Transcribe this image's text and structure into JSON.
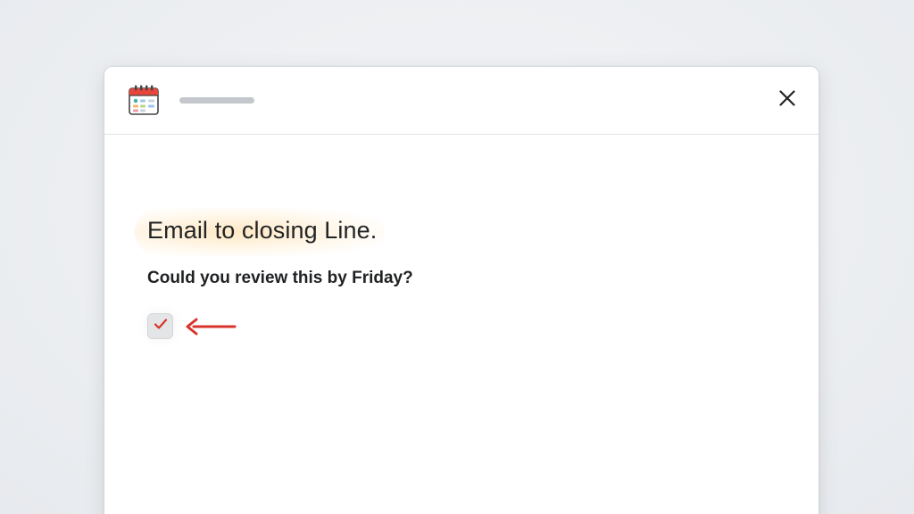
{
  "window": {
    "title": ""
  },
  "icons": {
    "app": "calendar-icon",
    "close": "close-icon",
    "check": "check-icon",
    "arrow": "arrow-left-icon"
  },
  "message": {
    "breadcrumb": "",
    "subject": "Email to closing Line.",
    "question": "Could you review this by Friday?",
    "checkbox_checked": true
  },
  "colors": {
    "accent": "#d9342b",
    "highlight": "#ffd696",
    "background": "#e9ecef"
  }
}
